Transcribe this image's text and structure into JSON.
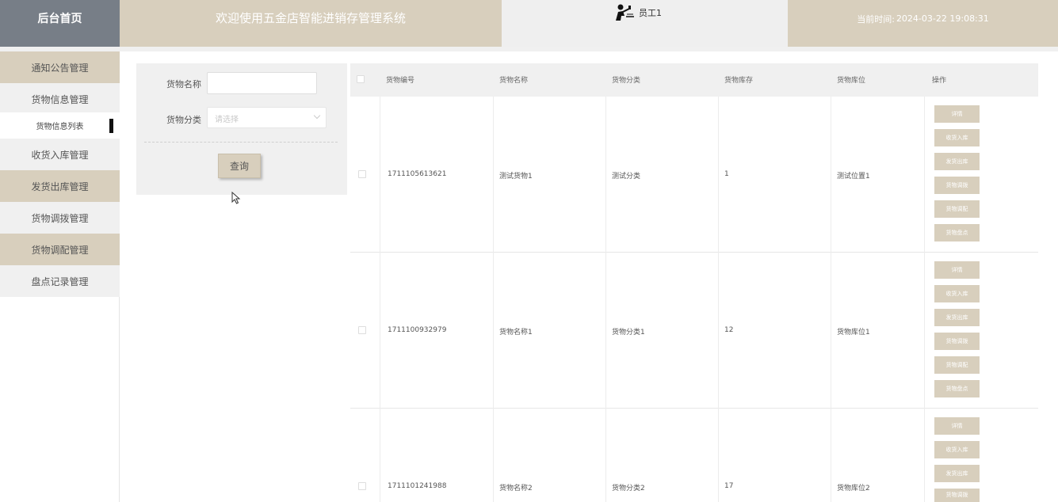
{
  "header": {
    "home_label": "后台首页",
    "title": "欢迎使用五金店智能进销存管理系统",
    "user_name": "员工1",
    "time_label": "当前时间:",
    "time_value": "2024-03-22 19:08:31"
  },
  "sidebar": {
    "items": [
      {
        "label": "通知公告管理"
      },
      {
        "label": "货物信息管理"
      },
      {
        "label": "货物信息列表"
      },
      {
        "label": "收货入库管理"
      },
      {
        "label": "发货出库管理"
      },
      {
        "label": "货物调拨管理"
      },
      {
        "label": "货物调配管理"
      },
      {
        "label": "盘点记录管理"
      }
    ]
  },
  "search": {
    "name_label": "货物名称",
    "name_value": "",
    "category_label": "货物分类",
    "category_placeholder": "请选择",
    "query_button": "查询"
  },
  "table": {
    "headers": [
      "货物编号",
      "货物名称",
      "货物分类",
      "货物库存",
      "货物库位",
      "操作"
    ],
    "rows": [
      {
        "id": "1711105613621",
        "name": "测试货物1",
        "category": "测试分类",
        "stock": "1",
        "location": "测试位置1"
      },
      {
        "id": "1711100932979",
        "name": "货物名称1",
        "category": "货物分类1",
        "stock": "12",
        "location": "货物库位1"
      },
      {
        "id": "1711101241988",
        "name": "货物名称2",
        "category": "货物分类2",
        "stock": "17",
        "location": "货物库位2"
      }
    ],
    "actions": [
      "详情",
      "收货入库",
      "发货出库",
      "货物调拨",
      "货物调配",
      "货物盘点"
    ]
  },
  "colors": {
    "accent": "#d8cfbd",
    "home_bg": "#777e87",
    "panel_bg": "#f0f0f0"
  },
  "icons": {
    "user_avatar": "user-avatar-icon",
    "cursor": "mouse-pointer-icon"
  }
}
